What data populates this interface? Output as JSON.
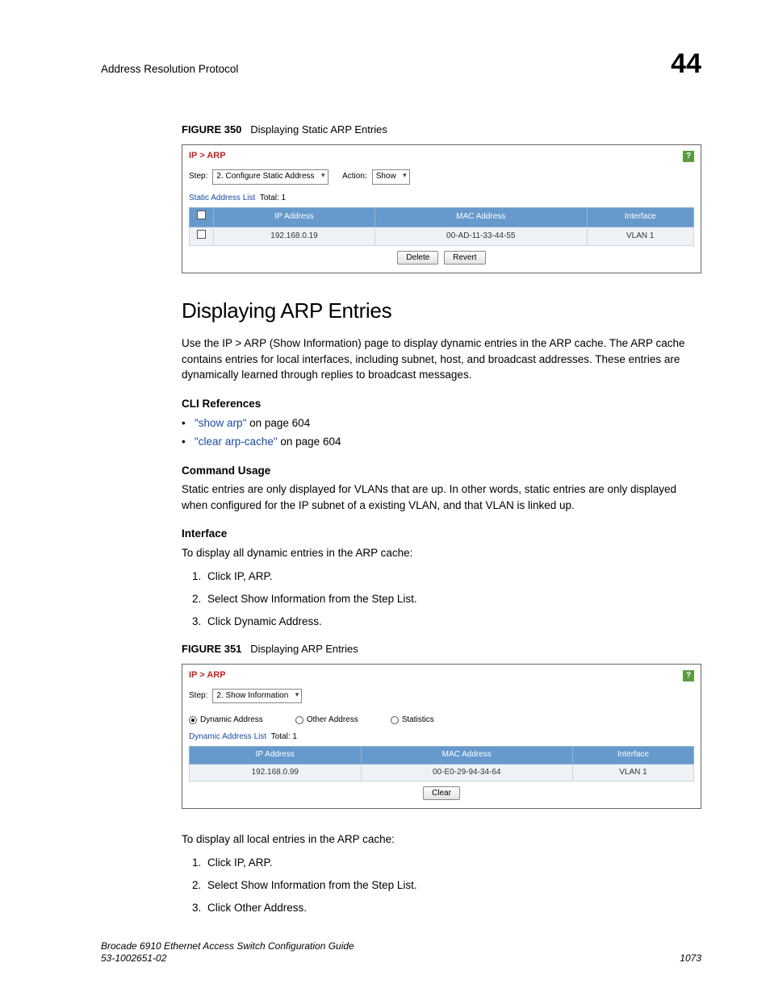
{
  "header": {
    "section": "Address Resolution Protocol",
    "chapter": "44"
  },
  "fig350": {
    "label": "FIGURE 350",
    "caption": "Displaying Static ARP Entries",
    "breadcrumb": "IP > ARP",
    "step_label": "Step:",
    "step_dropdown": "2. Configure Static Address",
    "action_label": "Action:",
    "action_dropdown": "Show",
    "list_title": "Static Address List",
    "total_label": "Total:",
    "total_value": "1",
    "cols": {
      "ip": "IP Address",
      "mac": "MAC Address",
      "iface": "Interface"
    },
    "row": {
      "ip": "192.168.0.19",
      "mac": "00-AD-11-33-44-55",
      "iface": "VLAN 1"
    },
    "btn_delete": "Delete",
    "btn_revert": "Revert"
  },
  "section_title": "Displaying ARP Entries",
  "intro": "Use the IP > ARP (Show Information) page to display dynamic entries in the ARP cache. The ARP cache contains entries for local interfaces, including subnet, host, and broadcast addresses. These entries are dynamically learned through replies to broadcast messages.",
  "cli_h": "CLI References",
  "cli": {
    "a_link": "\"show arp\"",
    "a_rest": " on page 604",
    "b_link": "\"clear arp-cache\"",
    "b_rest": " on page 604"
  },
  "usage_h": "Command Usage",
  "usage_body": "Static entries are only displayed for VLANs that are up. In other words, static entries are only displayed when configured for the IP subnet of a existing VLAN, and that VLAN is linked up.",
  "iface_h": "Interface",
  "iface_intro": "To display all dynamic entries in the ARP cache:",
  "steps_a": {
    "s1": "Click IP, ARP.",
    "s2": "Select Show Information from the Step List.",
    "s3": "Click Dynamic Address."
  },
  "fig351": {
    "label": "FIGURE 351",
    "caption": "Displaying ARP Entries",
    "breadcrumb": "IP > ARP",
    "step_label": "Step:",
    "step_dropdown": "2. Show Information",
    "radios": {
      "dyn": "Dynamic Address",
      "other": "Other Address",
      "stats": "Statistics"
    },
    "list_title": "Dynamic Address List",
    "total_label": "Total:",
    "total_value": "1",
    "cols": {
      "ip": "IP Address",
      "mac": "MAC Address",
      "iface": "Interface"
    },
    "row": {
      "ip": "192.168.0.99",
      "mac": "00-E0-29-94-34-64",
      "iface": "VLAN 1"
    },
    "btn_clear": "Clear"
  },
  "local_intro": "To display all local entries in the ARP cache:",
  "steps_b": {
    "s1": "Click IP, ARP.",
    "s2": "Select Show Information from the Step List.",
    "s3": "Click Other Address."
  },
  "footer": {
    "guide": "Brocade 6910 Ethernet Access Switch Configuration Guide",
    "doc": "53-1002651-02",
    "page": "1073"
  }
}
